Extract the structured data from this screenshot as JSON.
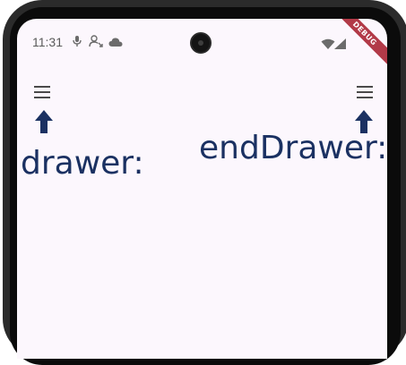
{
  "status_bar": {
    "time": "11:31",
    "icons": [
      "mic-icon",
      "person-sync-icon",
      "cloud-icon",
      "wifi-icon",
      "signal-icon"
    ]
  },
  "debug_banner": {
    "label": "DEBUG",
    "color": "#b23a48"
  },
  "app": {
    "background": "#fcf7fd",
    "accent": "#1b3162",
    "drawer_label": "drawer:",
    "end_drawer_label": "endDrawer:",
    "left_menu_icon": "menu-icon",
    "right_menu_icon": "menu-icon",
    "arrow_icon": "arrow-up-icon"
  }
}
